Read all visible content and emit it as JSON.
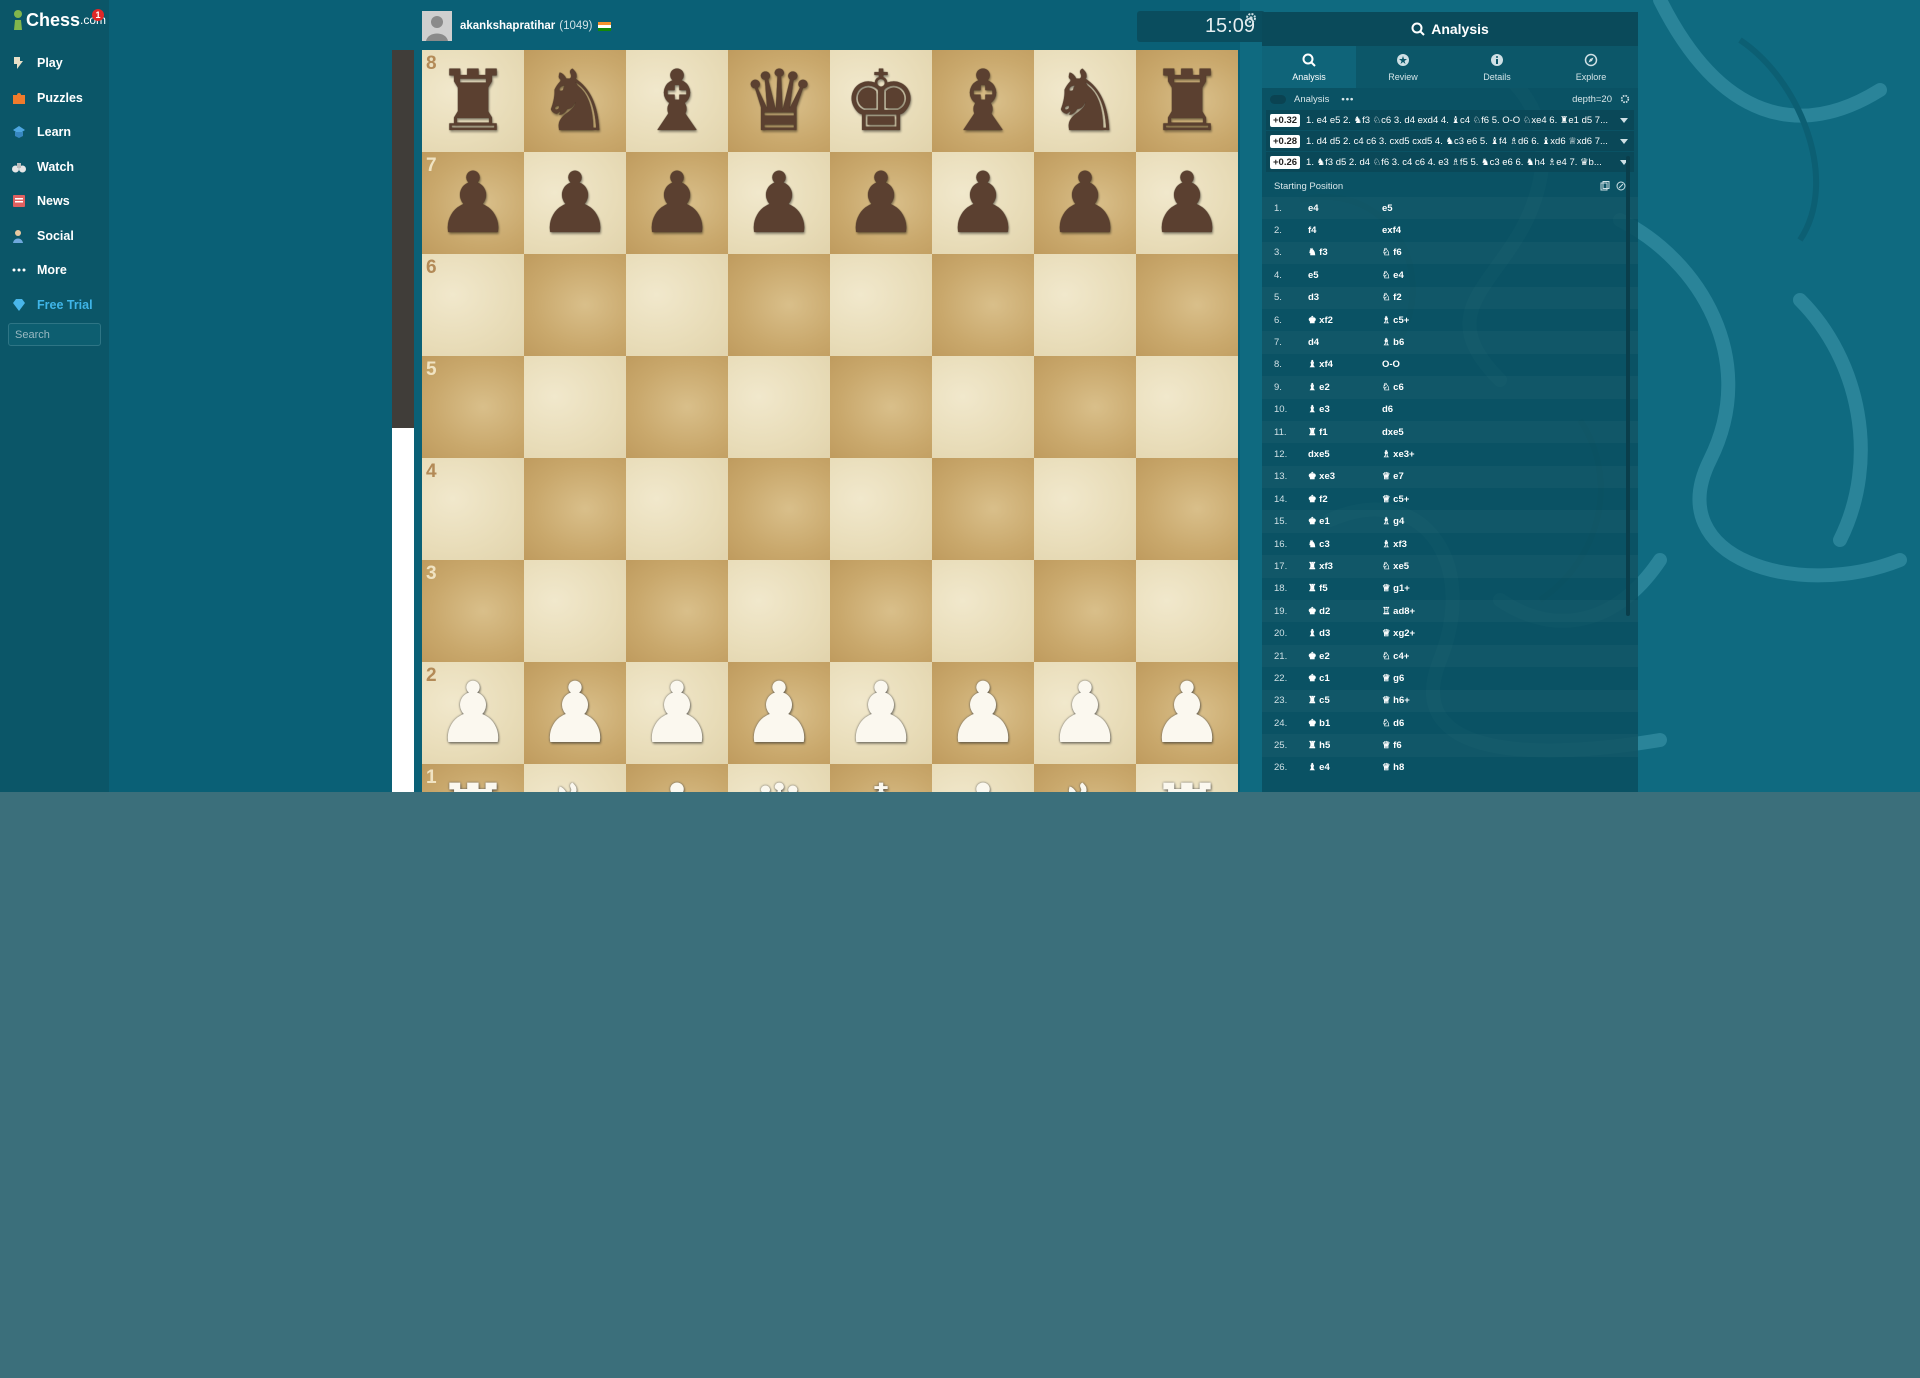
{
  "brand": {
    "logo_main": "Chess",
    "logo_suffix": ".com",
    "notification_count": "1"
  },
  "sidebar": {
    "items": [
      {
        "label": "Play",
        "icon": "play-icon"
      },
      {
        "label": "Puzzles",
        "icon": "puzzle-icon"
      },
      {
        "label": "Learn",
        "icon": "learn-icon"
      },
      {
        "label": "Watch",
        "icon": "binoculars-icon"
      },
      {
        "label": "News",
        "icon": "news-icon"
      },
      {
        "label": "Social",
        "icon": "social-icon"
      },
      {
        "label": "More",
        "icon": "more-icon"
      },
      {
        "label": "Free Trial",
        "icon": "diamond-icon"
      }
    ],
    "search_placeholder": "Search"
  },
  "player": {
    "name": "akankshapratihar",
    "rating": "(1049)",
    "flag": "india"
  },
  "clock": "15:09",
  "board": {
    "ranks": [
      "8",
      "7",
      "6",
      "5",
      "4",
      "3",
      "2",
      "1"
    ],
    "position": [
      [
        "♜",
        "♞",
        "♝",
        "♛",
        "♚",
        "♝",
        "♞",
        "♜"
      ],
      [
        "♟",
        "♟",
        "♟",
        "♟",
        "♟",
        "♟",
        "♟",
        "♟"
      ],
      [
        "",
        "",
        "",
        "",
        "",
        "",
        "",
        ""
      ],
      [
        "",
        "",
        "",
        "",
        "",
        "",
        "",
        ""
      ],
      [
        "",
        "",
        "",
        "",
        "",
        "",
        "",
        ""
      ],
      [
        "",
        "",
        "",
        "",
        "",
        "",
        "",
        ""
      ],
      [
        "♟",
        "♟",
        "♟",
        "♟",
        "♟",
        "♟",
        "♟",
        "♟"
      ],
      [
        "♜",
        "♞",
        "♝",
        "♛",
        "♚",
        "♝",
        "♞",
        "♜"
      ]
    ],
    "eval_white_fraction": 0.49
  },
  "panel": {
    "title": "Analysis",
    "tabs": [
      {
        "label": "Analysis",
        "icon": "magnifier-icon"
      },
      {
        "label": "Review",
        "icon": "star-icon"
      },
      {
        "label": "Details",
        "icon": "info-icon"
      },
      {
        "label": "Explore",
        "icon": "compass-icon"
      }
    ],
    "analysis_label": "Analysis",
    "analysis_toggle": true,
    "depth": "depth=20",
    "lines": [
      {
        "score": "+0.32",
        "text": "1. e4 e5 2. ♞f3 ♘c6 3. d4 exd4 4. ♝c4 ♘f6 5. O-O ♘xe4 6. ♜e1 d5 7..."
      },
      {
        "score": "+0.28",
        "text": "1. d4 d5 2. c4 c6 3. cxd5 cxd5 4. ♞c3 e6 5. ♝f4 ♗d6 6. ♝xd6 ♕xd6 7..."
      },
      {
        "score": "+0.26",
        "text": "1. ♞f3 d5 2. d4 ♘f6 3. c4 c6 4. e3 ♗f5 5. ♞c3 e6 6. ♞h4 ♗e4 7. ♛b..."
      }
    ],
    "starting_position": "Starting Position",
    "moves": [
      {
        "n": "1.",
        "w": "e4",
        "b": "e5"
      },
      {
        "n": "2.",
        "w": "f4",
        "b": "exf4"
      },
      {
        "n": "3.",
        "w": "♞ f3",
        "b": "♘ f6"
      },
      {
        "n": "4.",
        "w": "e5",
        "b": "♘ e4"
      },
      {
        "n": "5.",
        "w": "d3",
        "b": "♘ f2"
      },
      {
        "n": "6.",
        "w": "♚ xf2",
        "b": "♗ c5+"
      },
      {
        "n": "7.",
        "w": "d4",
        "b": "♗ b6"
      },
      {
        "n": "8.",
        "w": "♝ xf4",
        "b": "O-O"
      },
      {
        "n": "9.",
        "w": "♝ e2",
        "b": "♘ c6"
      },
      {
        "n": "10.",
        "w": "♝ e3",
        "b": "d6"
      },
      {
        "n": "11.",
        "w": "♜ f1",
        "b": "dxe5"
      },
      {
        "n": "12.",
        "w": "dxe5",
        "b": "♗ xe3+"
      },
      {
        "n": "13.",
        "w": "♚ xe3",
        "b": "♕ e7"
      },
      {
        "n": "14.",
        "w": "♚ f2",
        "b": "♕ c5+"
      },
      {
        "n": "15.",
        "w": "♚ e1",
        "b": "♗ g4"
      },
      {
        "n": "16.",
        "w": "♞ c3",
        "b": "♗ xf3"
      },
      {
        "n": "17.",
        "w": "♜ xf3",
        "b": "♘ xe5"
      },
      {
        "n": "18.",
        "w": "♜ f5",
        "b": "♕ g1+"
      },
      {
        "n": "19.",
        "w": "♚ d2",
        "b": "♖ ad8+"
      },
      {
        "n": "20.",
        "w": "♝ d3",
        "b": "♕ xg2+"
      },
      {
        "n": "21.",
        "w": "♚ e2",
        "b": "♘ c4+"
      },
      {
        "n": "22.",
        "w": "♚ c1",
        "b": "♕ g6"
      },
      {
        "n": "23.",
        "w": "♜ c5",
        "b": "♕ h6+"
      },
      {
        "n": "24.",
        "w": "♚ b1",
        "b": "♘ d6"
      },
      {
        "n": "25.",
        "w": "♜ h5",
        "b": "♕ f6"
      },
      {
        "n": "26.",
        "w": "♝ e4",
        "b": "♕ h8"
      }
    ]
  },
  "colors": {
    "bg": "#0a6076",
    "sidebar": "#0b5668",
    "trial": "#3fb5e8",
    "board_light": "#e8dcb8",
    "board_dark": "#c9a86c"
  }
}
